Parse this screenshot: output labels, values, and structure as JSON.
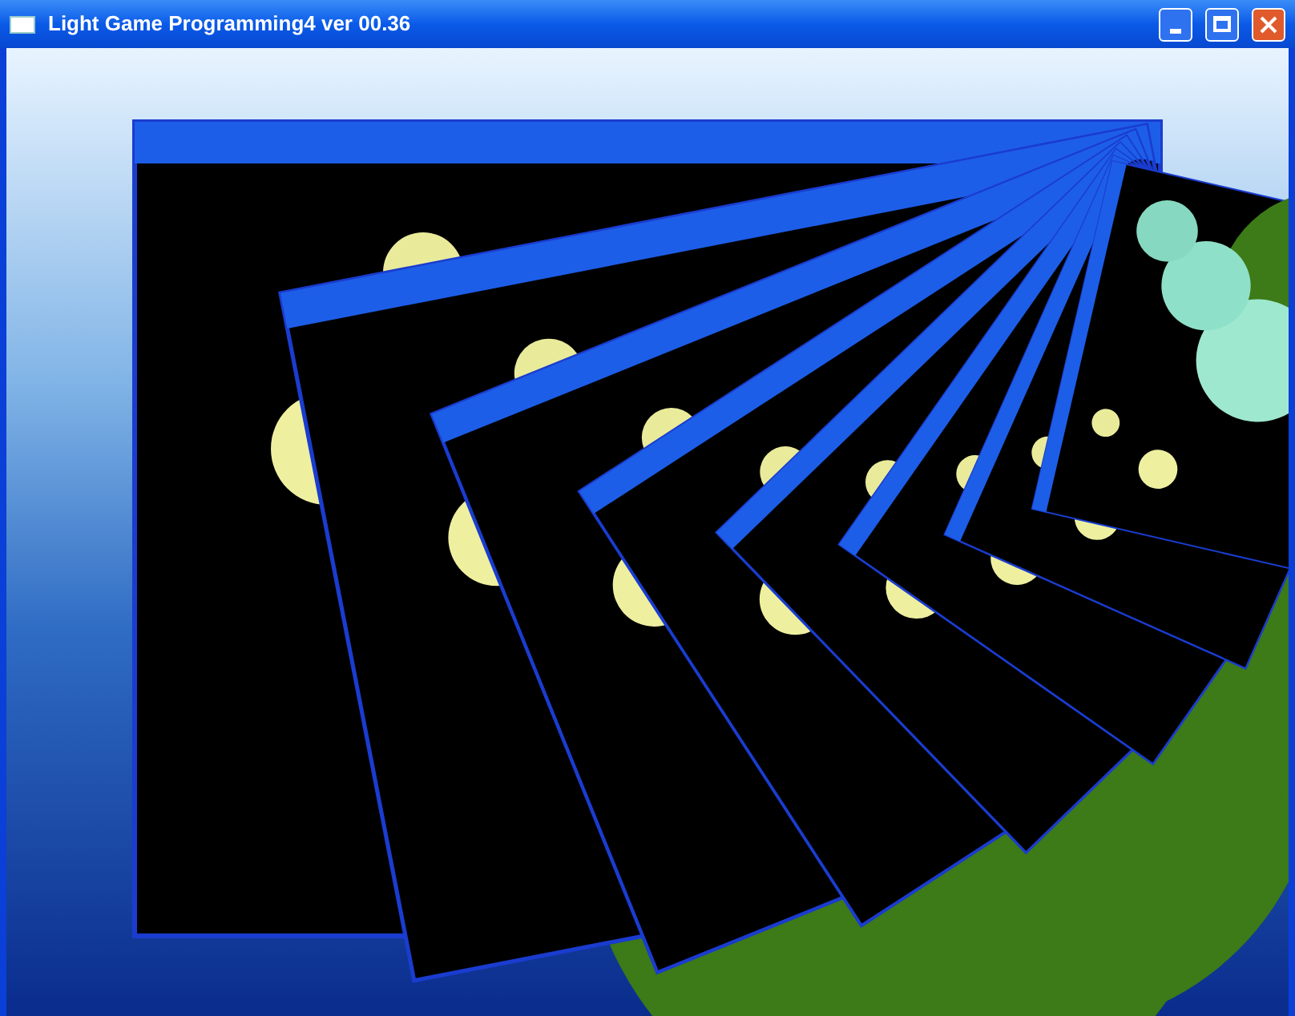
{
  "window": {
    "title": "Light Game Programming4 ver 00.36"
  }
}
